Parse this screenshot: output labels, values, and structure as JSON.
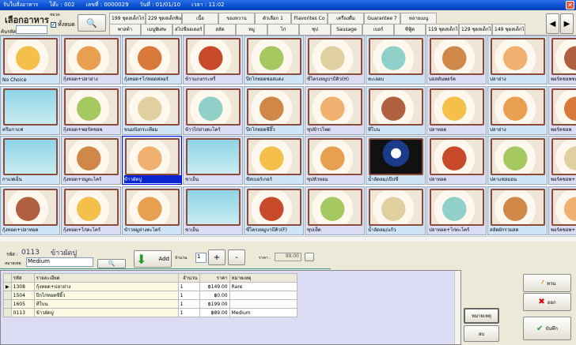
{
  "titlebar": {
    "app": "รับใบสั่งอาหาร",
    "table": "โต๊ะ : 002",
    "number": "เลขที่ : 0000029",
    "date": "วันที่ : 01/01/10",
    "time": "เวลา : 11:02"
  },
  "header": {
    "title": "เลือกอาหาร",
    "search_label": "ค้นรหัส",
    "search_value": "",
    "group_label": "หมวด",
    "all_label": "ทั้งหมด",
    "all_checked": true
  },
  "tabs": {
    "row1": [
      "199 ชุดสเต็กไก่",
      "229 ชุดสเต็กพิเศษ",
      "เนื้อ",
      "ของหวาน",
      "ตัวเลือก 1",
      "Flavorites Co",
      "เครื่องดื่ม",
      "Guarantee 7",
      "หลายเมนู"
    ],
    "row2": [
      "พาสต้า",
      "เมนูพิเศษ",
      "สไปซี่ออเดอร์",
      "สลัด",
      "หมู",
      "ไก่",
      "ซุป",
      "Sausage",
      "เบอร์",
      "ซีฟู้ด",
      "119 ชุดสเต็กไก่",
      "129 ชุดสเต็กไก่",
      "149 ชุดสเต็กไก่"
    ]
  },
  "menu": [
    [
      "No Choice",
      "กุ้งทอด+ปลาย่าง",
      "กุ้งทอด+ไก่ทอดฟลอร์",
      "ข้าวแกงกระหรี่",
      "ปีกไก่ทอดซอสแดง",
      "ซี่โครงหมูบาบีคิว(H)",
      "ทะเลอบ",
      "บอสตันพอร์ค",
      "ปลาย่าง",
      "พอร์คชอพซอส"
    ],
    [
      "ครีมกาแฟ",
      "กุ้งทอด+พอร์คชอพ",
      "ขนมปังกระเทียม",
      "ข้าวไก่ย่างตะไคร้",
      "ปีกไก่ทอดซีอิ๊ว",
      "ซุปข้าวโพด",
      "ทีโบน",
      "ปลาทอด",
      "ปลาย่าง",
      "พอร์คชอพ"
    ],
    [
      "กาแฟเย็น",
      "กุ้งทอด+หมูตะไคร้",
      "ข้าวผัดปู",
      "ชาเย็น",
      "ชีสเบอร์เกอร์",
      "ซุปหัวหอม",
      "น้ำอัดลม/เป๊ปซี่",
      "ปลาทอด",
      "ปลาแซลมอน",
      "พอร์คชอพ+"
    ],
    [
      "กุ้งทอด+ปลาทอด",
      "กุ้งทอด+ไก่ตะไคร้",
      "ข้าวหมูย่างตะไคร้",
      "ชาเย็น",
      "ซี่โครงหมูบาบีคิว(F)",
      "ซุปเห็ด",
      "น้ำอัดลม/แก้ว",
      "ปลาทอด+ไก่ตะไคร้",
      "สลัดผักรวมสด",
      "พอร์คชอพ+"
    ]
  ],
  "selected": {
    "code_label": "รหัส :",
    "code": "0113",
    "name": "ข้าวผัดปู",
    "note_label": "หมายเหตุ",
    "note": "Medium",
    "add": "Add",
    "qty_label": "จำนวน",
    "qty": "1",
    "plus": "+",
    "minus": "-",
    "price_label": "ราคา :",
    "price": "89.00"
  },
  "order": {
    "headers": [
      "รหัส",
      "รายละเอียด",
      "จำนวน",
      "ราคา",
      "หมายเหตุ"
    ],
    "rows": [
      [
        "1308",
        "กุ้งทอด+ปลาย่าง",
        "1",
        "฿149.00",
        "Rare"
      ],
      [
        "1504",
        "ปีกไก่ทอดซีอิ๊ว",
        "1",
        "฿0.00",
        ""
      ],
      [
        "1605",
        "ทีโบน",
        "1",
        "฿199.00",
        ""
      ],
      [
        "0113",
        "ข้าวผัดปู",
        "1",
        "฿89.00",
        "Medium"
      ]
    ]
  },
  "buttons": {
    "note": "หมายเหตุ",
    "delete": "ลบ",
    "review": "ทวน",
    "exit": "ออก",
    "save": "บันทึก"
  }
}
